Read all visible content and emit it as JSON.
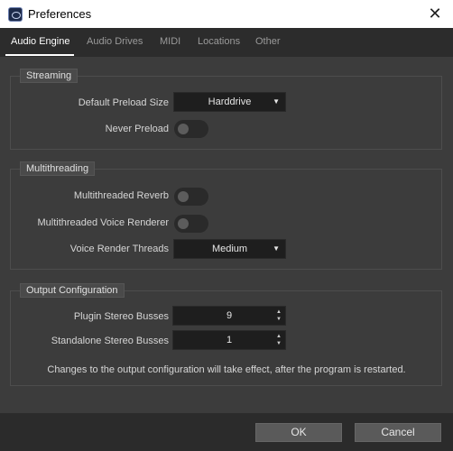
{
  "window": {
    "title": "Preferences",
    "app_icon": "audio-app-icon"
  },
  "tabs": [
    {
      "label": "Audio Engine",
      "active": true
    },
    {
      "label": "Audio Drives",
      "active": false
    },
    {
      "label": "MIDI",
      "active": false
    },
    {
      "label": "Locations",
      "active": false
    },
    {
      "label": "Other",
      "active": false
    }
  ],
  "streaming": {
    "title": "Streaming",
    "default_preload_label": "Default Preload Size",
    "default_preload_value": "Harddrive",
    "never_preload_label": "Never Preload",
    "never_preload_on": false
  },
  "multithreading": {
    "title": "Multithreading",
    "reverb_label": "Multithreaded Reverb",
    "reverb_on": false,
    "voice_renderer_label": "Multithreaded Voice Renderer",
    "voice_renderer_on": false,
    "threads_label": "Voice Render Threads",
    "threads_value": "Medium"
  },
  "output": {
    "title": "Output Configuration",
    "plugin_busses_label": "Plugin Stereo Busses",
    "plugin_busses_value": "9",
    "standalone_busses_label": "Standalone Stereo Busses",
    "standalone_busses_value": "1",
    "note": "Changes to the output configuration will take effect, after the program is restarted."
  },
  "footer": {
    "ok_label": "OK",
    "cancel_label": "Cancel"
  },
  "colors": {
    "background": "#3c3c3c",
    "tabbar": "#2c2c2c",
    "field": "#1e1e1e",
    "button": "#5a5a5a"
  }
}
